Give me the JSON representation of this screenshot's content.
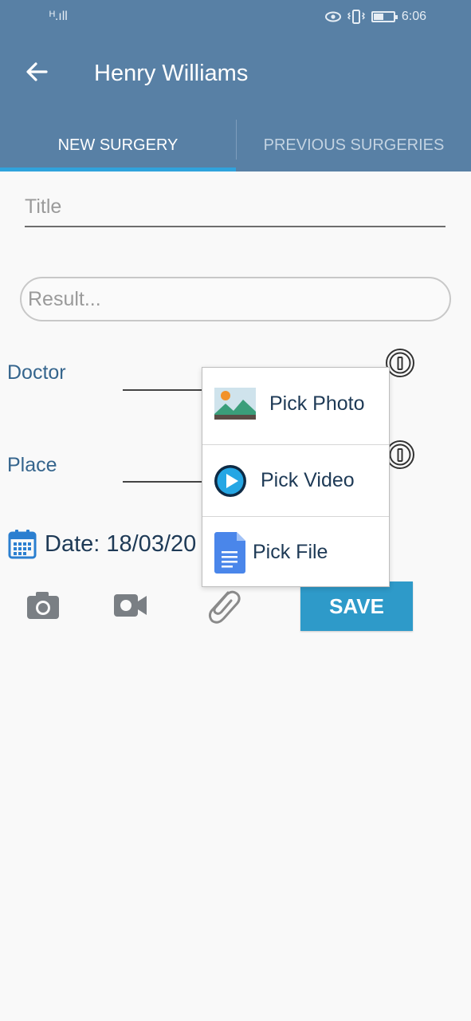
{
  "status_bar": {
    "signal": "ᴴ.ıll",
    "time": "6:06"
  },
  "header": {
    "title": "Henry Williams"
  },
  "tabs": [
    {
      "label": "NEW SURGERY",
      "active": true
    },
    {
      "label": "PREVIOUS SURGERIES",
      "active": false
    }
  ],
  "form": {
    "title_placeholder": "Title",
    "result_placeholder": "Result...",
    "doctor_label": "Doctor",
    "place_label": "Place",
    "date_text": "Date: 18/03/20"
  },
  "actions": {
    "save_label": "SAVE"
  },
  "popup_menu": {
    "items": [
      {
        "label": "Pick Photo",
        "icon": "photo-icon"
      },
      {
        "label": "Pick Video",
        "icon": "play-icon"
      },
      {
        "label": "Pick File",
        "icon": "document-icon"
      }
    ]
  },
  "colors": {
    "appbar": "#5880a5",
    "tab_indicator": "#2fa3dd",
    "save_button": "#2e9ac9",
    "label_text": "#35658d"
  }
}
